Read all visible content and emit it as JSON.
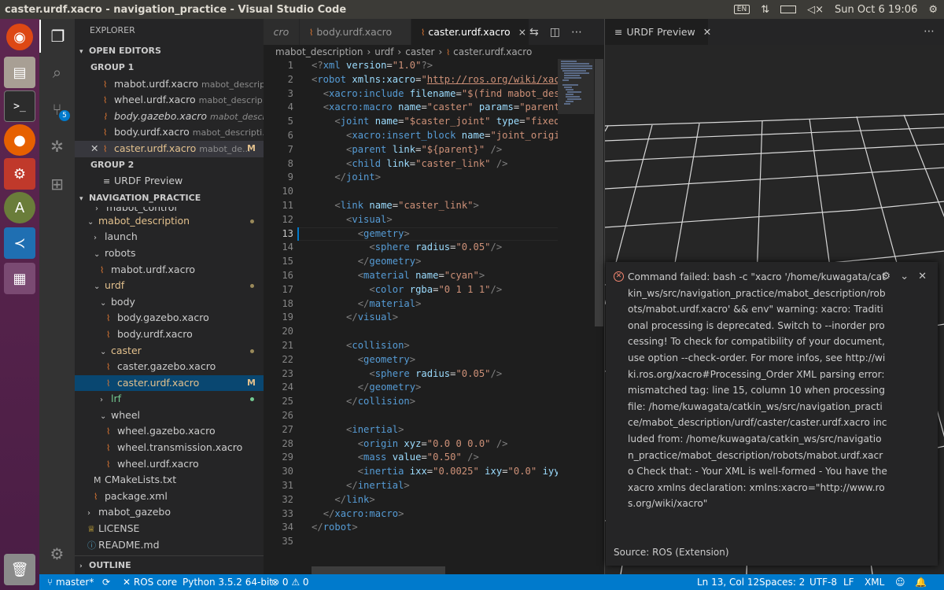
{
  "window": {
    "title": "caster.urdf.xacro - navigation_practice - Visual Studio Code",
    "clock": "Sun Oct  6 19:06",
    "keyboard_label": "EN"
  },
  "activity": {
    "scm_badge": "5"
  },
  "explorer": {
    "title": "EXPLORER",
    "open_editors_header": "OPEN EDITORS",
    "group1_label": "GROUP 1",
    "group2_label": "GROUP 2",
    "open_editors": [
      {
        "name": "mabot.urdf.xacro",
        "desc": "mabot_descriptio..."
      },
      {
        "name": "wheel.urdf.xacro",
        "desc": "mabot_descrip..."
      },
      {
        "name": "body.gazebo.xacro",
        "desc": "mabot_descri..."
      },
      {
        "name": "body.urdf.xacro",
        "desc": "mabot_descripti..."
      },
      {
        "name": "caster.urdf.xacro",
        "desc": "mabot_de...",
        "mark": "M"
      }
    ],
    "group2_items": [
      {
        "name": "URDF Preview"
      }
    ],
    "project_header": "NAVIGATION_PRACTICE",
    "tree": {
      "cut_item": "mabot_control",
      "mabot_description": "mabot_description",
      "launch": "launch",
      "robots": "robots",
      "robots_file": "mabot.urdf.xacro",
      "urdf": "urdf",
      "body": "body",
      "body_gazebo": "body.gazebo.xacro",
      "body_urdf": "body.urdf.xacro",
      "caster": "caster",
      "caster_gazebo": "caster.gazebo.xacro",
      "caster_urdf": "caster.urdf.xacro",
      "caster_urdf_mark": "M",
      "lrf": "lrf",
      "wheel": "wheel",
      "wheel_gazebo": "wheel.gazebo.xacro",
      "wheel_transmission": "wheel.transmission.xacro",
      "wheel_urdf": "wheel.urdf.xacro",
      "cmakelists": "CMakeLists.txt",
      "package_xml": "package.xml",
      "mabot_gazebo": "mabot_gazebo",
      "license": "LICENSE",
      "readme": "README.md"
    },
    "outline_header": "OUTLINE"
  },
  "editor1": {
    "tabs": [
      {
        "name": "cro"
      },
      {
        "name": "body.urdf.xacro"
      },
      {
        "name": "caster.urdf.xacro",
        "close": "×"
      }
    ],
    "breadcrumbs": [
      "mabot_description",
      "urdf",
      "caster",
      "caster.urdf.xacro"
    ]
  },
  "editor2": {
    "tab": "URDF Preview"
  },
  "notification": {
    "message": "Command failed: bash -c \"xacro '/home/kuwagata/catkin_ws/src/navigation_practice/mabot_description/robots/mabot.urdf.xacro' && env\" warning: xacro: Traditional processing is deprecated. Switch to --inorder processing! To check for compatibility of your document, use option --check-order. For more infos, see http://wiki.ros.org/xacro#Processing_Order XML parsing error: mismatched tag: line 15, column 10 when processing file: /home/kuwagata/catkin_ws/src/navigation_practice/mabot_description/urdf/caster/caster.urdf.xacro included from: /home/kuwagata/catkin_ws/src/navigation_practice/mabot_description/robots/mabot.urdf.xacro Check that: - Your XML is well-formed - You have the xacro xmlns declaration: xmlns:xacro=\"http://www.ros.org/wiki/xacro\"",
    "source": "Source: ROS (Extension)"
  },
  "statusbar": {
    "branch": "master*",
    "sync": "⟳",
    "ros": "ROS core",
    "python": "Python 3.5.2 64-bit",
    "errors": "0",
    "warnings": "0",
    "position": "Ln 13, Col 12",
    "spaces": "Spaces: 2",
    "encoding": "UTF-8",
    "eol": "LF",
    "language": "XML"
  },
  "colors": {
    "accent": "#007acc",
    "ubuntu_launcher": "#5e2750",
    "error": "#f48771"
  }
}
